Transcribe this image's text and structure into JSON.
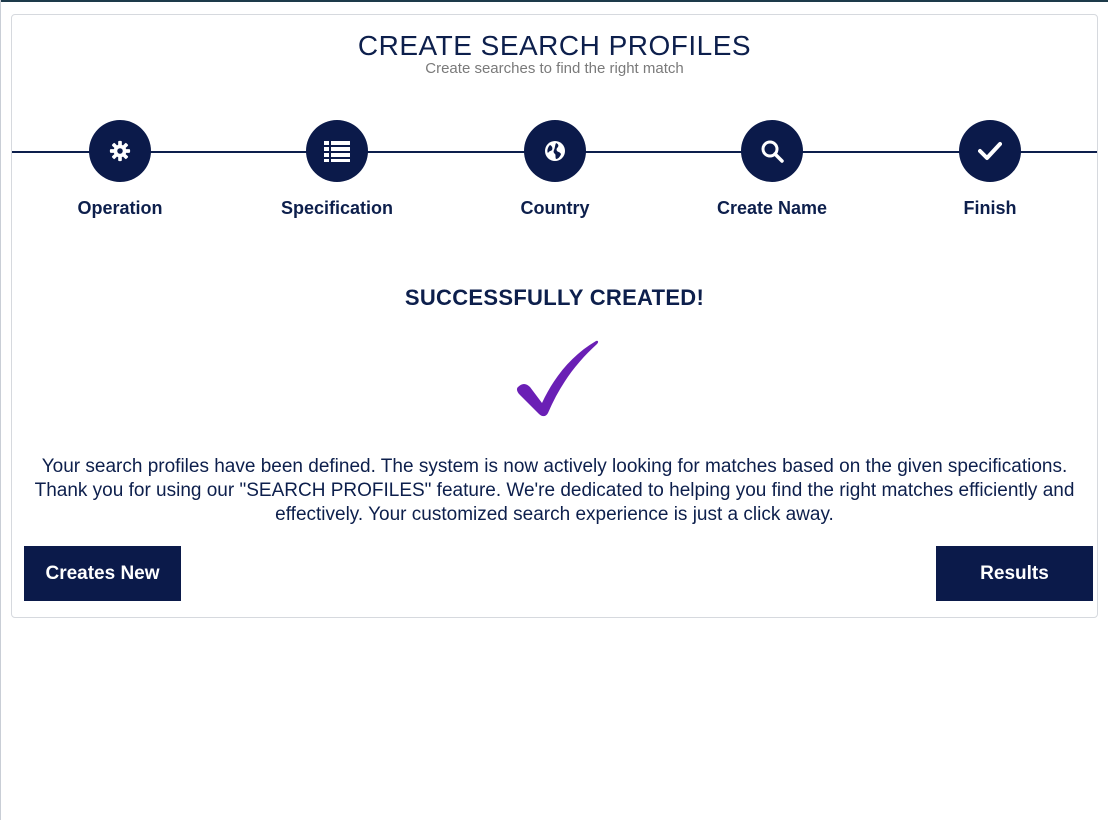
{
  "header": {
    "title": "CREATE SEARCH PROFILES",
    "subtitle": "Create searches to find the right match"
  },
  "steps": [
    {
      "label": "Operation",
      "icon": "gear-icon"
    },
    {
      "label": "Specification",
      "icon": "list-icon"
    },
    {
      "label": "Country",
      "icon": "globe-icon"
    },
    {
      "label": "Create Name",
      "icon": "search-icon"
    },
    {
      "label": "Finish",
      "icon": "check-icon"
    }
  ],
  "success": {
    "title": "SUCCESSFULLY CREATED!",
    "icon": "checkmark-icon",
    "message": "Your search profiles have been defined. The system is now actively looking for matches based on the given specifications. Thank you for using our \"SEARCH PROFILES\" feature. We're dedicated to helping you find the right matches efficiently and effectively. Your customized search experience is just a click away."
  },
  "actions": {
    "create_new_label": "Creates New",
    "results_label": "Results"
  },
  "colors": {
    "primary": "#0b1a4a",
    "check_accent": "#6a1fb5",
    "subtitle": "#7a7a7a"
  }
}
